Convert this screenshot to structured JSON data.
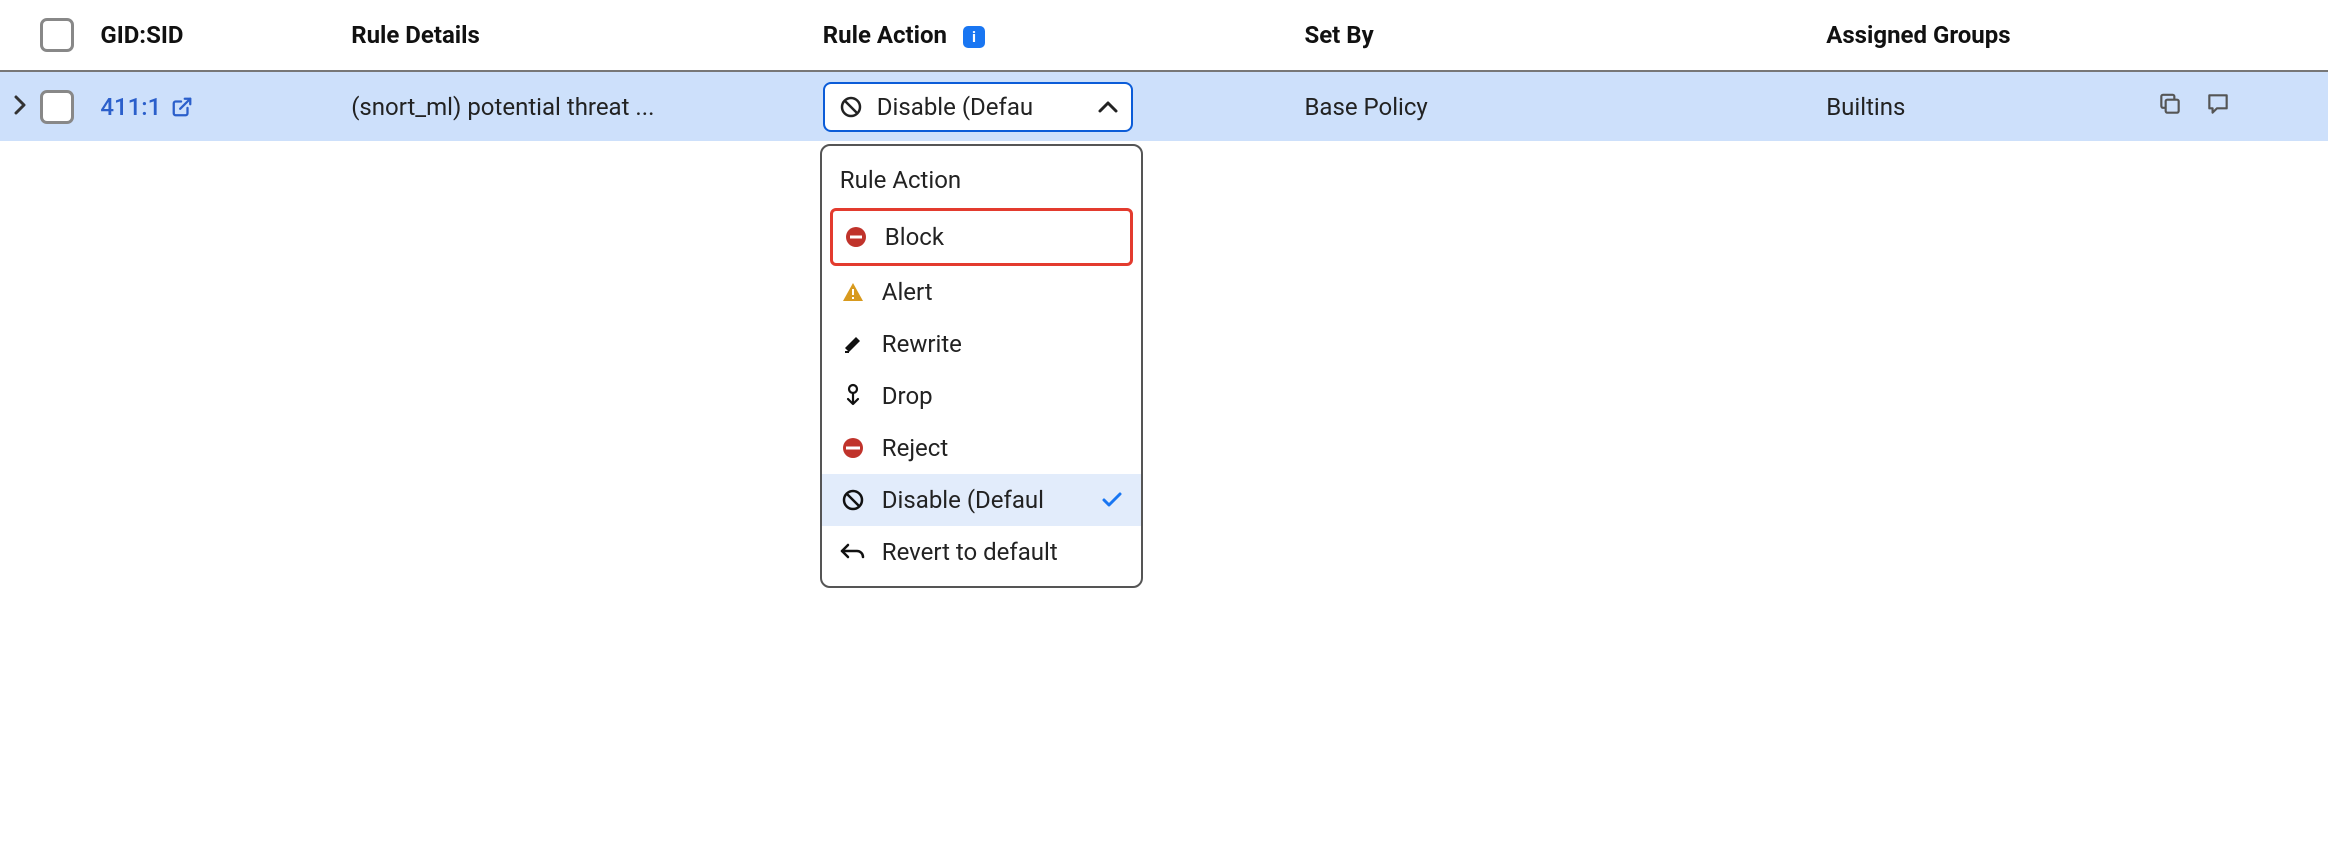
{
  "header": {
    "gidsid": "GID:SID",
    "details": "Rule Details",
    "action": "Rule Action",
    "info_badge": "i",
    "setby": "Set By",
    "groups": "Assigned Groups"
  },
  "row": {
    "gidsid": "411:1",
    "details": "(snort_ml) potential threat ...",
    "action_selected": "Disable (Defau",
    "setby": "Base Policy",
    "groups": "Builtins"
  },
  "dropdown": {
    "heading": "Rule Action",
    "items": {
      "block": "Block",
      "alert": "Alert",
      "rewrite": "Rewrite",
      "drop": "Drop",
      "reject": "Reject",
      "disable": "Disable (Defaul",
      "revert": "Revert to default"
    }
  }
}
